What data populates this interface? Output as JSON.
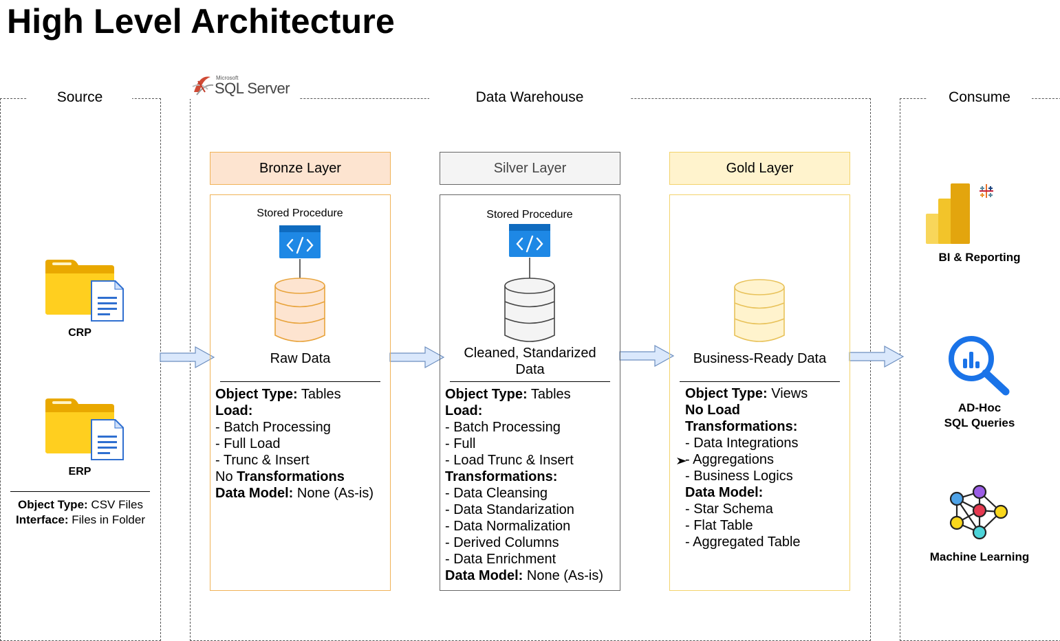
{
  "title": "High Level Architecture",
  "colors": {
    "bronze_fill": "#fde4d0",
    "bronze_border": "#f0b256",
    "silver_fill": "#f4f4f4",
    "silver_border": "#666666",
    "gold_fill": "#fff3cd",
    "gold_border": "#f3d36b",
    "arrow_fill": "#dae8fc",
    "arrow_stroke": "#6c8ebf",
    "folder": "#f5c518",
    "procedure": "#1e88e5"
  },
  "sections": {
    "source": "Source",
    "warehouse": "Data Warehouse",
    "consume": "Consume"
  },
  "sql_logo": {
    "small": "Microsoft",
    "main": "SQL Server"
  },
  "sources": {
    "items": [
      {
        "name": "CRP",
        "icon": "folder-document-icon"
      },
      {
        "name": "ERP",
        "icon": "folder-document-icon"
      }
    ],
    "object_type_label": "Object Type:",
    "object_type_value": "CSV Files",
    "interface_label": "Interface:",
    "interface_value": "Files in Folder"
  },
  "layers": {
    "bronze": {
      "title": "Bronze Layer",
      "procedure": "Stored Procedure",
      "data": "Raw Data",
      "object_type_label": "Object Type:",
      "object_type_value": "Tables",
      "load_label": "Load:",
      "load_items": [
        "- Batch Processing",
        "- Full Load",
        "- Trunc & Insert"
      ],
      "transform_prefix": "No",
      "transform_label": "Transformations",
      "model_label": "Data Model:",
      "model_value": "None (As-is)"
    },
    "silver": {
      "title": "Silver Layer",
      "procedure": "Stored Procedure",
      "data_line1": "Cleaned, Standarized",
      "data_line2": "Data",
      "object_type_label": "Object Type:",
      "object_type_value": "Tables",
      "load_label": "Load:",
      "load_items": [
        "- Batch Processing",
        "- Full",
        "- Load Trunc & Insert"
      ],
      "transform_label": "Transformations:",
      "transform_items": [
        "- Data Cleansing",
        "- Data Standarization",
        "- Data Normalization",
        "- Derived Columns",
        "- Data Enrichment"
      ],
      "model_label": "Data Model:",
      "model_value": "None (As-is)"
    },
    "gold": {
      "title": "Gold Layer",
      "data": "Business-Ready Data",
      "object_type_label": "Object Type:",
      "object_type_value": "Views",
      "load_label": "No Load",
      "transform_label": "Transformations:",
      "transform_items": [
        "- Data Integrations",
        "- Aggregations",
        "- Business Logics"
      ],
      "model_label": "Data Model:",
      "model_items": [
        "- Star Schema",
        "- Flat Table",
        "- Aggregated Table"
      ]
    }
  },
  "consume": [
    {
      "label": "BI & Reporting",
      "icon": "power-bi-icon"
    },
    {
      "label1": "AD-Hoc",
      "label2": "SQL Queries",
      "icon": "magnifier-chart-icon"
    },
    {
      "label": "Machine Learning",
      "icon": "neural-network-icon"
    }
  ]
}
